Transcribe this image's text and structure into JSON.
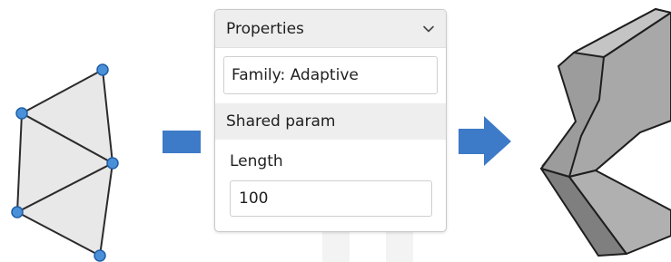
{
  "panel": {
    "title": "Properties",
    "family_text": "Family: Adaptive",
    "section_label": "Shared param",
    "field_label": "Length",
    "field_value": "100"
  },
  "icons": {
    "panel_collapse": "chevron-down-icon",
    "process_arrow": "arrow-right-icon"
  },
  "colors": {
    "accent_blue": "#3d7ac7",
    "node_blue": "#4a90d9",
    "triangle_fill": "#e8e8e8",
    "solid_top": "#b8b8b8",
    "solid_front": "#8f8f8f",
    "watermark": "#f3f3f3"
  }
}
